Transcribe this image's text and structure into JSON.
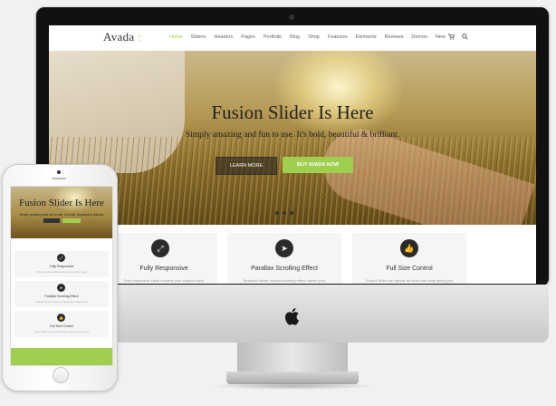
{
  "colors": {
    "accent": "#a0ce4e",
    "dark": "#2b2b2b"
  },
  "site": {
    "logo": "Avada",
    "logo_suffix": ":",
    "menu": [
      "Home",
      "Sliders",
      "Headers",
      "Pages",
      "Portfolio",
      "Blog",
      "Shop",
      "Features",
      "Elements",
      "Reviews",
      "Demos",
      "New"
    ],
    "icons": {
      "cart": "cart-icon",
      "search": "search-icon"
    }
  },
  "hero": {
    "title": "Fusion Slider Is Here",
    "subtitle": "Simply amazing and fun to use. It's bold, beautiful & brilliant.",
    "btn_more": "LEARN MORE",
    "btn_buy": "BUY AVADA NOW"
  },
  "features": [
    {
      "icon": "expand-icon",
      "title": "Fully Responsive",
      "text": "Fully responsive slider ensures your content looks"
    },
    {
      "icon": "rocket-icon",
      "title": "Parallax Scrolling Effect",
      "text": "Beautiful fusher smooth scrolling effect makes your"
    },
    {
      "icon": "thumbs-up-icon",
      "title": "Full Size Control",
      "text": "Fusion Slider can handle all sizes with ease giving you"
    }
  ],
  "mobile": {
    "title": "Fusion Slider Is Here",
    "subtitle": "Simply amazing and fun to use. It's bold, beautiful & brilliant.",
    "features": [
      {
        "title": "Fully Responsive",
        "text": "Fully responsive slider ensures your content looks"
      },
      {
        "title": "Parallax Scrolling Effect",
        "text": "Beautiful fusher smooth scrolling effect makes your"
      },
      {
        "title": "Full Size Control",
        "text": "Fusion Slider can handle all sizes with ease giving you"
      }
    ]
  }
}
